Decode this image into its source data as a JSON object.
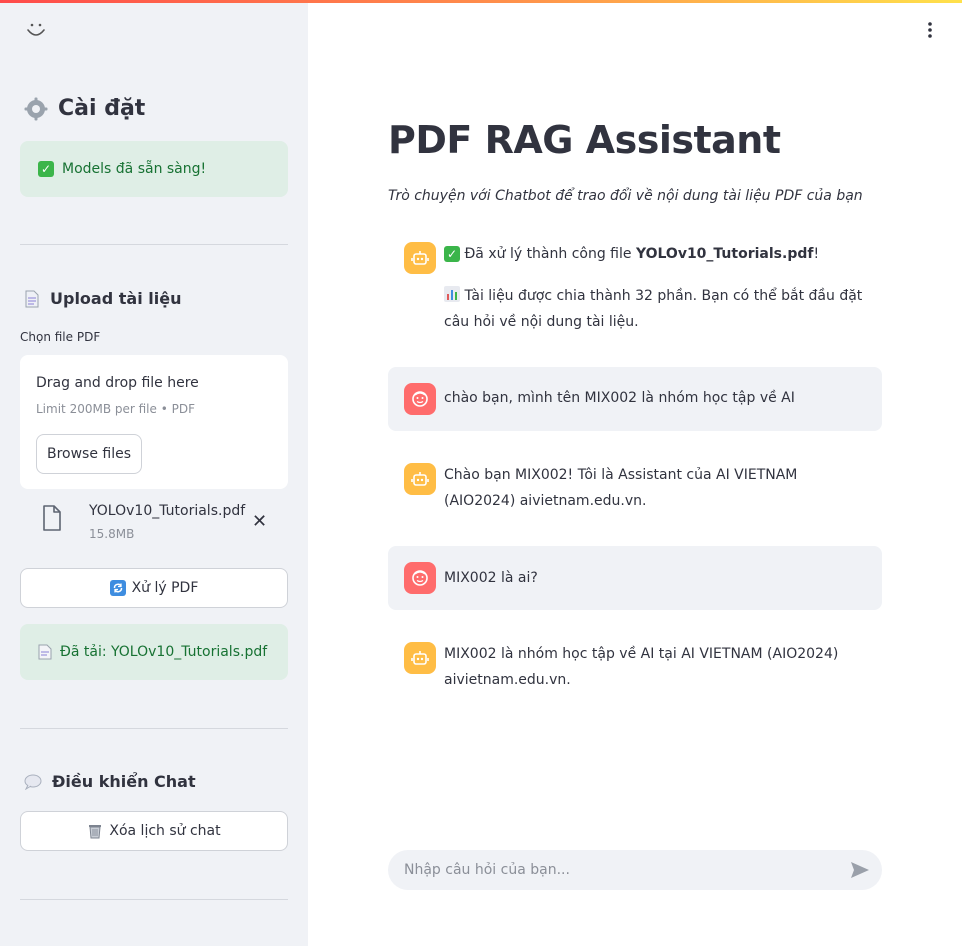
{
  "sidebar": {
    "settings_title": "Cài đặt",
    "models_ready": "Models đã sẵn sàng!",
    "upload_title": "Upload tài liệu",
    "choose_file_label": "Chọn file PDF",
    "dropzone_title": "Drag and drop file here",
    "dropzone_limit": "Limit 200MB per file • PDF",
    "browse_label": "Browse files",
    "file_name": "YOLOv10_Tutorials.pdf",
    "file_size": "15.8MB",
    "process_label": "Xử lý PDF",
    "loaded_label": "Đã tải: YOLOv10_Tutorials.pdf",
    "chat_control_title": "Điều khiển Chat",
    "clear_chat_label": "Xóa lịch sử chat"
  },
  "main": {
    "title": "PDF RAG Assistant",
    "subtitle": "Trò chuyện với Chatbot để trao đổi về nội dung tài liệu PDF của bạn",
    "messages": [
      {
        "role": "assistant",
        "line1_prefix": "Đã xử lý thành công file ",
        "line1_bold": "YOLOv10_Tutorials.pdf",
        "line1_suffix": "!",
        "line2": "Tài liệu được chia thành 32 phần. Bạn có thể bắt đầu đặt câu hỏi về nội dung tài liệu."
      },
      {
        "role": "user",
        "text": "chào bạn, mình tên MIX002 là nhóm học tập về AI"
      },
      {
        "role": "assistant",
        "text": "Chào bạn MIX002! Tôi là Assistant của AI VIETNAM (AIO2024) aivietnam.edu.vn."
      },
      {
        "role": "user",
        "text": "MIX002 là ai?"
      },
      {
        "role": "assistant",
        "text": "MIX002 là nhóm học tập về AI tại AI VIETNAM (AIO2024) aivietnam.edu.vn."
      }
    ],
    "input_placeholder": "Nhập câu hỏi của bạn..."
  },
  "colors": {
    "accent": "#ff4b4b",
    "success_bg": "#dfeee6",
    "success_text": "#177233",
    "bot_avatar": "#ffbd45",
    "user_avatar": "#ff6c6c"
  }
}
